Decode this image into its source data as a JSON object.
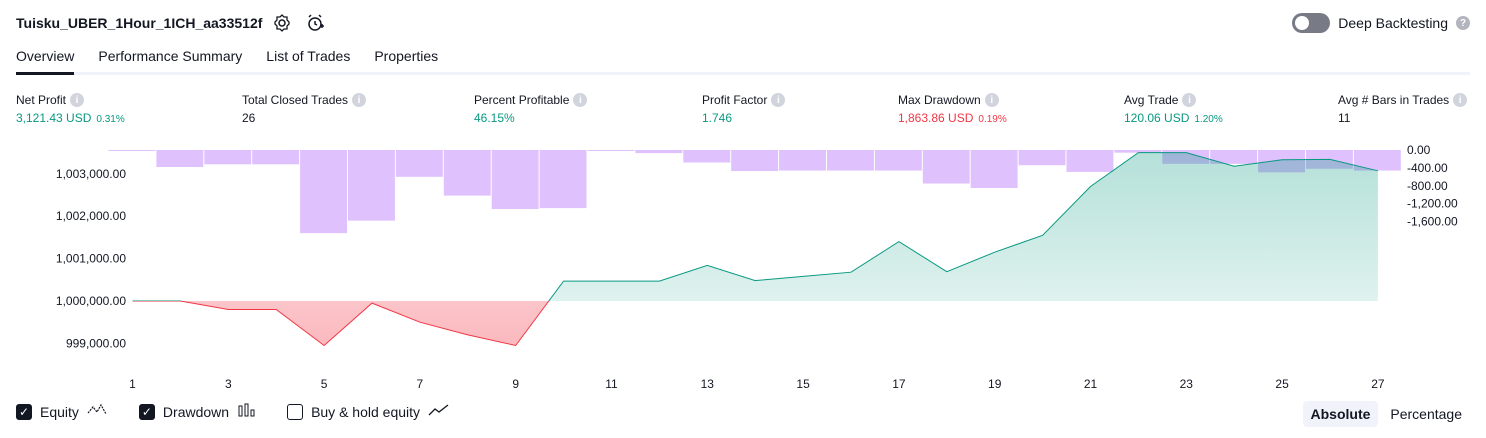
{
  "header": {
    "strategy_name": "Tuisku_UBER_1Hour_1ICH_aa33512f",
    "deep_backtesting_label": "Deep Backtesting",
    "deep_backtesting_enabled": false
  },
  "tabs": [
    {
      "label": "Overview",
      "active": true
    },
    {
      "label": "Performance Summary",
      "active": false
    },
    {
      "label": "List of Trades",
      "active": false
    },
    {
      "label": "Properties",
      "active": false
    }
  ],
  "metrics": [
    {
      "label": "Net Profit",
      "value": "3,121.43 USD",
      "pct": "0.31%",
      "color": "#089981"
    },
    {
      "label": "Total Closed Trades",
      "value": "26",
      "pct": "",
      "color": "#131722"
    },
    {
      "label": "Percent Profitable",
      "value": "46.15%",
      "pct": "",
      "color": "#089981"
    },
    {
      "label": "Profit Factor",
      "value": "1.746",
      "pct": "",
      "color": "#089981"
    },
    {
      "label": "Max Drawdown",
      "value": "1,863.86 USD",
      "pct": "0.19%",
      "color": "#f23645"
    },
    {
      "label": "Avg Trade",
      "value": "120.06 USD",
      "pct": "1.20%",
      "color": "#089981"
    },
    {
      "label": "Avg # Bars in Trades",
      "value": "11",
      "pct": "",
      "color": "#131722"
    }
  ],
  "chart_data": {
    "type": "line",
    "x_ticks": [
      "1",
      "3",
      "5",
      "7",
      "9",
      "11",
      "13",
      "15",
      "17",
      "19",
      "21",
      "23",
      "25",
      "27"
    ],
    "left_axis_ticks": [
      "1,003,000.00",
      "1,002,000.00",
      "1,001,000.00",
      "1,000,000.00",
      "999,000.00"
    ],
    "right_axis_ticks": [
      "0.00",
      "-400.00",
      "-800.00",
      "-1,200.00",
      "-1,600.00"
    ],
    "equity_baseline": 1000000,
    "equity": {
      "name": "Equity",
      "x": [
        1,
        2,
        3,
        4,
        5,
        6,
        7,
        8,
        9,
        10,
        11,
        12,
        13,
        14,
        15,
        16,
        17,
        18,
        19,
        20,
        21,
        22,
        23,
        24,
        25,
        26,
        27
      ],
      "values": [
        1000000,
        1000000,
        999800,
        999800,
        998950,
        999950,
        999500,
        999200,
        998950,
        1000470,
        1000470,
        1000470,
        1000840,
        1000480,
        1000580,
        1000680,
        1001400,
        1000690,
        1001150,
        1001550,
        1002700,
        1003500,
        1003500,
        1003180,
        1003330,
        1003340,
        1003070
      ]
    },
    "drawdown": {
      "name": "Drawdown",
      "x": [
        1,
        2,
        3,
        4,
        5,
        6,
        7,
        8,
        9,
        10,
        11,
        12,
        13,
        14,
        15,
        16,
        17,
        18,
        19,
        20,
        21,
        22,
        23,
        24,
        25,
        26,
        27
      ],
      "values": [
        -10,
        -380,
        -320,
        -320,
        -1860,
        -1580,
        -600,
        -1020,
        -1320,
        -1300,
        -20,
        -70,
        -280,
        -470,
        -460,
        -460,
        -460,
        -750,
        -850,
        -340,
        -490,
        -60,
        -310,
        -310,
        -500,
        -420,
        -460
      ]
    },
    "colors": {
      "equity_up": "#089981",
      "equity_down": "#f23645",
      "drawdown": "#c084fc"
    }
  },
  "legend": {
    "equity": {
      "label": "Equity",
      "checked": true
    },
    "drawdown": {
      "label": "Drawdown",
      "checked": true
    },
    "buyhold": {
      "label": "Buy & hold equity",
      "checked": false
    }
  },
  "mode": {
    "absolute": "Absolute",
    "percentage": "Percentage",
    "active": "Absolute"
  }
}
